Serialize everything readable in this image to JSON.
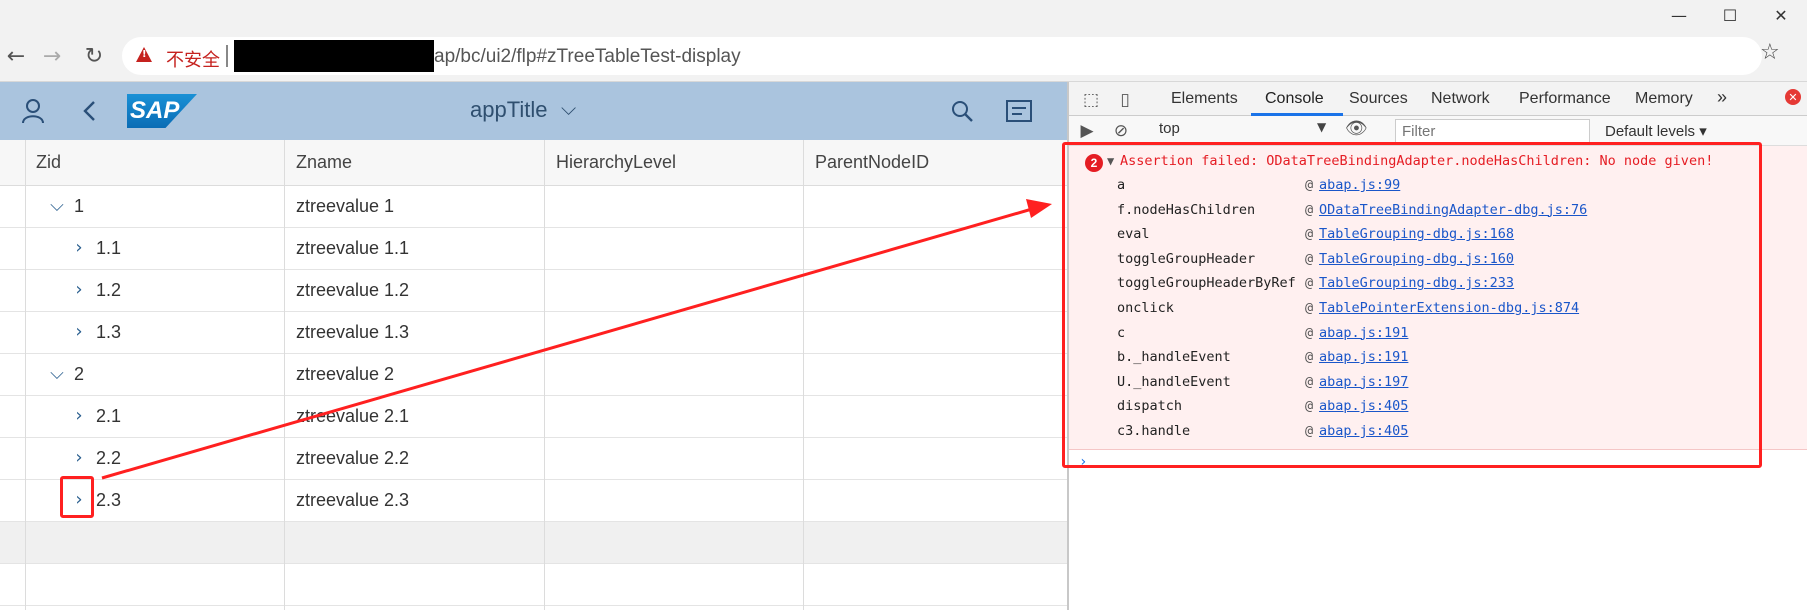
{
  "window": {
    "minimize": "—",
    "maximize": "☐",
    "close": "✕"
  },
  "browser": {
    "back": "←",
    "forward": "→",
    "reload": "↻",
    "security_label": "不安全",
    "url_visible": "ap/bc/ui2/flp#zTreeTableTest-display",
    "star": "☆"
  },
  "shell": {
    "title": "appTitle",
    "title_chevron": "⌵",
    "logo_text": "SAP",
    "icons": [
      "user-icon",
      "back-icon",
      "search-icon",
      "menu-icon"
    ]
  },
  "table": {
    "columns": [
      "Zid",
      "Zname",
      "HierarchyLevel",
      "ParentNodeID"
    ],
    "rows": [
      {
        "zid": "1",
        "zname": "ztreevalue 1",
        "level": 0,
        "expanded": true,
        "toggle": "⌵"
      },
      {
        "zid": "1.1",
        "zname": "ztreevalue 1.1",
        "level": 1,
        "expanded": false,
        "toggle": "›"
      },
      {
        "zid": "1.2",
        "zname": "ztreevalue 1.2",
        "level": 1,
        "expanded": false,
        "toggle": "›"
      },
      {
        "zid": "1.3",
        "zname": "ztreevalue 1.3",
        "level": 1,
        "expanded": false,
        "toggle": "›"
      },
      {
        "zid": "2",
        "zname": "ztreevalue 2",
        "level": 0,
        "expanded": true,
        "toggle": "⌵"
      },
      {
        "zid": "2.1",
        "zname": "ztreevalue 2.1",
        "level": 1,
        "expanded": false,
        "toggle": "›"
      },
      {
        "zid": "2.2",
        "zname": "ztreevalue 2.2",
        "level": 1,
        "expanded": false,
        "toggle": "›"
      },
      {
        "zid": "2.3",
        "zname": "ztreevalue 2.3",
        "level": 1,
        "expanded": false,
        "toggle": "›"
      }
    ]
  },
  "devtools": {
    "tabs": [
      "Elements",
      "Console",
      "Sources",
      "Network",
      "Performance",
      "Memory"
    ],
    "active_tab": "Console",
    "more": "»",
    "context": "top",
    "filter_placeholder": "Filter",
    "levels": "Default levels ▾",
    "error_count": "2",
    "error_message": "Assertion failed: ODataTreeBindingAdapter.nodeHasChildren: No node given!",
    "stack": [
      {
        "fn": "a",
        "src": "abap.js:99"
      },
      {
        "fn": "f.nodeHasChildren",
        "src": "ODataTreeBindingAdapter-dbg.js:76"
      },
      {
        "fn": "eval",
        "src": "TableGrouping-dbg.js:168"
      },
      {
        "fn": "toggleGroupHeader",
        "src": "TableGrouping-dbg.js:160"
      },
      {
        "fn": "toggleGroupHeaderByRef",
        "src": "TableGrouping-dbg.js:233"
      },
      {
        "fn": "onclick",
        "src": "TablePointerExtension-dbg.js:874"
      },
      {
        "fn": "c",
        "src": "abap.js:191"
      },
      {
        "fn": "b._handleEvent",
        "src": "abap.js:191"
      },
      {
        "fn": "U._handleEvent",
        "src": "abap.js:197"
      },
      {
        "fn": "dispatch",
        "src": "abap.js:405"
      },
      {
        "fn": "c3.handle",
        "src": "abap.js:405"
      }
    ],
    "prompt": "›"
  },
  "colors": {
    "shell": "#aac4de",
    "error": "#e51c23",
    "highlight": "#ff2020",
    "link": "#1a56c9"
  }
}
